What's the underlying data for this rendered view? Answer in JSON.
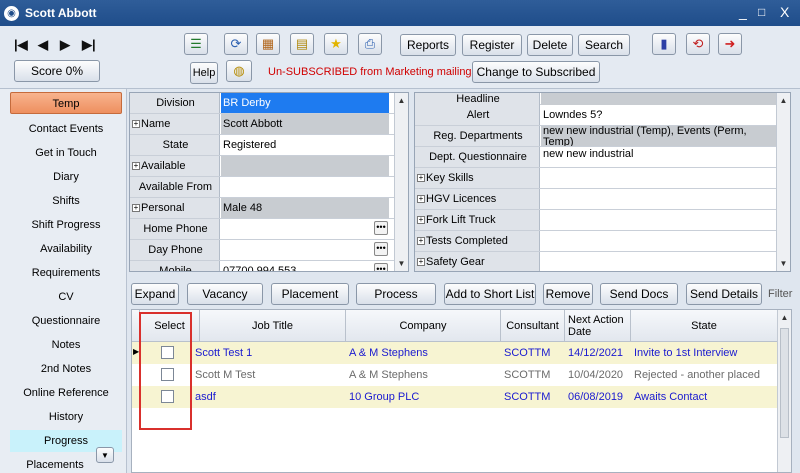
{
  "window": {
    "title": "Scott Abbott",
    "minimize": "_",
    "restore": "□",
    "close": "X"
  },
  "toolbar": {
    "nav": [
      "|◀",
      "◀",
      "▶",
      "▶|"
    ],
    "score": "Score 0%",
    "help": "Help",
    "buttons": [
      "Reports",
      "Register",
      "Delete",
      "Search"
    ],
    "unsubscribed": "Un-SUBSCRIBED from Marketing mailings",
    "change": "Change to Subscribed"
  },
  "sidebar": {
    "items": [
      "Temp",
      "Contact Events",
      "Get in Touch",
      "Diary",
      "Shifts",
      "Shift Progress",
      "Availability",
      "Requirements",
      "CV",
      "Questionnaire",
      "Notes",
      "2nd Notes",
      "Online Reference",
      "History",
      "Progress",
      "Placements"
    ]
  },
  "left_grid": {
    "rows": [
      {
        "label": "Division",
        "value": "BR Derby",
        "expand": false
      },
      {
        "label": "Name",
        "value": "Scott Abbott",
        "expand": true
      },
      {
        "label": "State",
        "value": "Registered",
        "expand": false
      },
      {
        "label": "Available",
        "value": "",
        "expand": true
      },
      {
        "label": "Available From",
        "value": "",
        "expand": false
      },
      {
        "label": "Personal",
        "value": "Male 48",
        "expand": true
      },
      {
        "label": "Home Phone",
        "value": "",
        "expand": false
      },
      {
        "label": "Day Phone",
        "value": "",
        "expand": false
      },
      {
        "label": "Mobile",
        "value": "07700 994 553",
        "expand": false
      }
    ]
  },
  "right_grid": {
    "rows": [
      {
        "label": "Headline",
        "value": "",
        "expand": false
      },
      {
        "label": "Alert",
        "value": "Lowndes 5?",
        "expand": false
      },
      {
        "label": "Reg. Departments",
        "value": "new new industrial (Temp), Events (Perm, Temp)",
        "expand": false
      },
      {
        "label": "Dept. Questionnaire",
        "value": "new new industrial",
        "expand": false
      },
      {
        "label": "Key Skills",
        "value": "",
        "expand": true
      },
      {
        "label": "HGV Licences",
        "value": "",
        "expand": true
      },
      {
        "label": "Fork Lift Truck",
        "value": "",
        "expand": true
      },
      {
        "label": "Tests Completed",
        "value": "",
        "expand": true
      },
      {
        "label": "Safety Gear",
        "value": "",
        "expand": true
      }
    ]
  },
  "actions": {
    "buttons": [
      "Expand",
      "Vacancy",
      "Placement",
      "Process",
      "Add to Short List",
      "Remove",
      "Send Docs",
      "Send Details"
    ],
    "filter": "Filter"
  },
  "jobs": {
    "columns": [
      "Select",
      "Job Title",
      "Company",
      "Consultant",
      "Next Action Date",
      "State"
    ],
    "rows": [
      {
        "title": "Scott Test 1",
        "company": "A & M Stephens",
        "consultant": "SCOTTM",
        "date": "14/12/2021",
        "state": "Invite to 1st Interview",
        "color": "#1a1ad0",
        "bg": "#f7f4d2",
        "current": true
      },
      {
        "title": "Scott M Test",
        "company": "A & M Stephens",
        "consultant": "SCOTTM",
        "date": "10/04/2020",
        "state": "Rejected - another placed",
        "color": "#6b6b6b",
        "bg": "#ffffff",
        "current": false
      },
      {
        "title": "asdf",
        "company": "10 Group PLC",
        "consultant": "SCOTTM",
        "date": "06/08/2019",
        "state": "Awaits Contact",
        "color": "#1a1ad0",
        "bg": "#f7f4d2",
        "current": false
      }
    ]
  },
  "colors": {
    "title_bar": "#1f4d8a",
    "active_tab": "#ee8f5f",
    "selected_value": "#1e7bf0",
    "unsubscribed_text": "#d00000",
    "highlight_box": "#d9302c"
  }
}
